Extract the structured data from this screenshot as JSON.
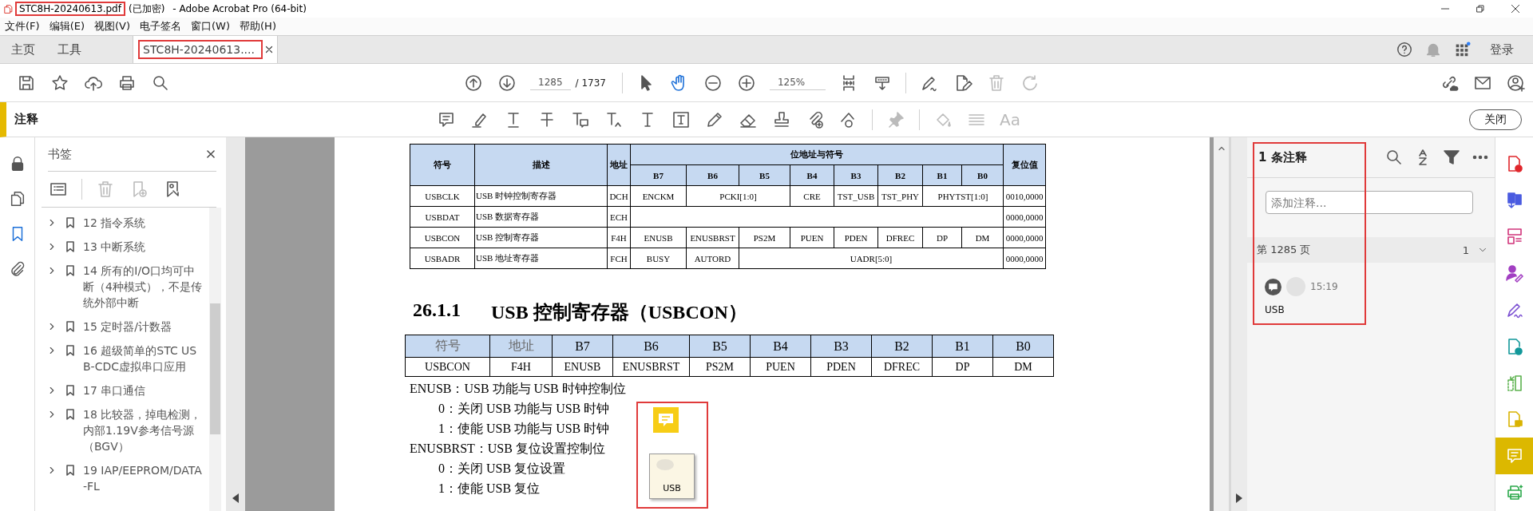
{
  "title_bar": {
    "file_name": "STC8H-20240613.pdf",
    "suffix": "(已加密)",
    "app": "- Adobe Acrobat Pro (64-bit)",
    "highlighted": true
  },
  "menu": [
    "文件(F)",
    "编辑(E)",
    "视图(V)",
    "电子签名",
    "窗口(W)",
    "帮助(H)"
  ],
  "tabs": [
    {
      "label": "主页",
      "kind": "home",
      "selected": false
    },
    {
      "label": "工具",
      "kind": "home",
      "selected": false
    },
    {
      "label": "STC8H-20240613....",
      "kind": "document",
      "selected": true,
      "highlighted": true
    }
  ],
  "sign_in": "登录",
  "toolbar": {
    "page_current": "1285",
    "page_total": "/ 1737",
    "zoom": "125%"
  },
  "comment_toolbar": {
    "title": "注释",
    "font_tool": "Aa",
    "close": "关闭"
  },
  "nav": [
    {
      "kind": "lock",
      "selected": false
    },
    {
      "kind": "pages",
      "selected": false
    },
    {
      "kind": "bookmarks",
      "selected": true
    },
    {
      "kind": "attachments",
      "selected": false
    }
  ],
  "bookmarks": {
    "title": "书签",
    "items": [
      {
        "label": "12  指令系统"
      },
      {
        "label": "13  中断系统"
      },
      {
        "label": "14  所有的I/O口均可中断（4种模式），不是传统外部中断"
      },
      {
        "label": "15  定时器/计数器"
      },
      {
        "label": "16  超级简单的STC USB-CDC虚拟串口应用"
      },
      {
        "label": "17  串口通信"
      },
      {
        "label": "18  比较器，掉电检测，内部1.19V参考信号源（BGV）"
      },
      {
        "label": "19  IAP/EEPROM/DATA-FL"
      }
    ]
  },
  "document": {
    "register_table": {
      "columns": {
        "symbol": "符号",
        "description": "描述",
        "address": "地址",
        "bits": "位地址与符号",
        "reset": "复位值"
      },
      "bit_headers": [
        "B7",
        "B6",
        "B5",
        "B4",
        "B3",
        "B2",
        "B1",
        "B0"
      ],
      "rows": [
        {
          "symbol": "USBCLK",
          "description": "USB 时钟控制寄存器",
          "address": "DCH",
          "reset": "0010,0000",
          "bits": [
            {
              "text": "ENCKM",
              "kind": "single"
            },
            {
              "text": "PCKI[1:0]",
              "kind": "double"
            },
            {
              "text": "CRE",
              "kind": "single"
            },
            {
              "text": "TST_USB",
              "kind": "single"
            },
            {
              "text": "TST_PHY",
              "kind": "single"
            },
            {
              "text": "PHYTST[1:0]",
              "kind": "double"
            }
          ]
        },
        {
          "symbol": "USBDAT",
          "description": "USB 数据寄存器",
          "address": "ECH",
          "reset": "0000,0000",
          "bits": [
            {
              "kind": "full"
            }
          ]
        },
        {
          "symbol": "USBCON",
          "description": "USB 控制寄存器",
          "address": "F4H",
          "reset": "0000,0000",
          "bits": [
            {
              "text": "ENUSB",
              "kind": "single"
            },
            {
              "text": "ENUSBRST",
              "kind": "single"
            },
            {
              "text": "PS2M",
              "kind": "single"
            },
            {
              "text": "PUEN",
              "kind": "single"
            },
            {
              "text": "PDEN",
              "kind": "single"
            },
            {
              "text": "DFREC",
              "kind": "single"
            },
            {
              "text": "DP",
              "kind": "single"
            },
            {
              "text": "DM",
              "kind": "single"
            }
          ]
        },
        {
          "symbol": "USBADR",
          "description": "USB 地址寄存器",
          "address": "FCH",
          "reset": "0000,0000",
          "bits": [
            {
              "text": "BUSY",
              "kind": "single"
            },
            {
              "text": "AUTORD",
              "kind": "single"
            },
            {
              "text": "UADR[5:0]",
              "kind": "six"
            }
          ]
        }
      ]
    },
    "heading_number": "26.1.1",
    "heading": "USB 控制寄存器（USBCON）",
    "bit_table": {
      "header": [
        "符号",
        "地址",
        "B7",
        "B6",
        "B5",
        "B4",
        "B3",
        "B2",
        "B1",
        "B0"
      ],
      "row": [
        "USBCON",
        "F4H",
        "ENUSB",
        "ENUSBRST",
        "PS2M",
        "PUEN",
        "PDEN",
        "DFREC",
        "DP",
        "DM"
      ]
    },
    "paragraphs": [
      {
        "text": "ENUSB：USB 功能与 USB 时钟控制位",
        "kind": "field"
      },
      {
        "text": "0：关闭 USB 功能与 USB 时钟",
        "kind": "value"
      },
      {
        "text": "1：使能 USB 功能与 USB 时钟",
        "kind": "value"
      },
      {
        "text": "ENUSBRST：USB 复位设置控制位",
        "kind": "field"
      },
      {
        "text": "0：关闭 USB 复位设置",
        "kind": "value"
      },
      {
        "text": "1：使能 USB 复位",
        "kind": "value"
      }
    ],
    "sticky_note": {
      "text": "USB",
      "highlighted": true
    }
  },
  "comments": {
    "title": "1 条注释",
    "placeholder": "添加注释...",
    "page_label": "第 1285 页",
    "count": "1",
    "items": [
      {
        "time": "15:19",
        "text": "USB"
      }
    ],
    "highlighted": true
  },
  "tools": [
    {
      "kind": "create",
      "selected": false
    },
    {
      "kind": "export",
      "selected": false
    },
    {
      "kind": "organize",
      "selected": false
    },
    {
      "kind": "request-sign",
      "selected": false
    },
    {
      "kind": "fill-sign",
      "selected": false
    },
    {
      "kind": "send",
      "selected": false
    },
    {
      "kind": "compare",
      "selected": false
    },
    {
      "kind": "note-doc",
      "selected": false
    },
    {
      "kind": "comment",
      "selected": true
    },
    {
      "kind": "print-production",
      "selected": false
    }
  ]
}
